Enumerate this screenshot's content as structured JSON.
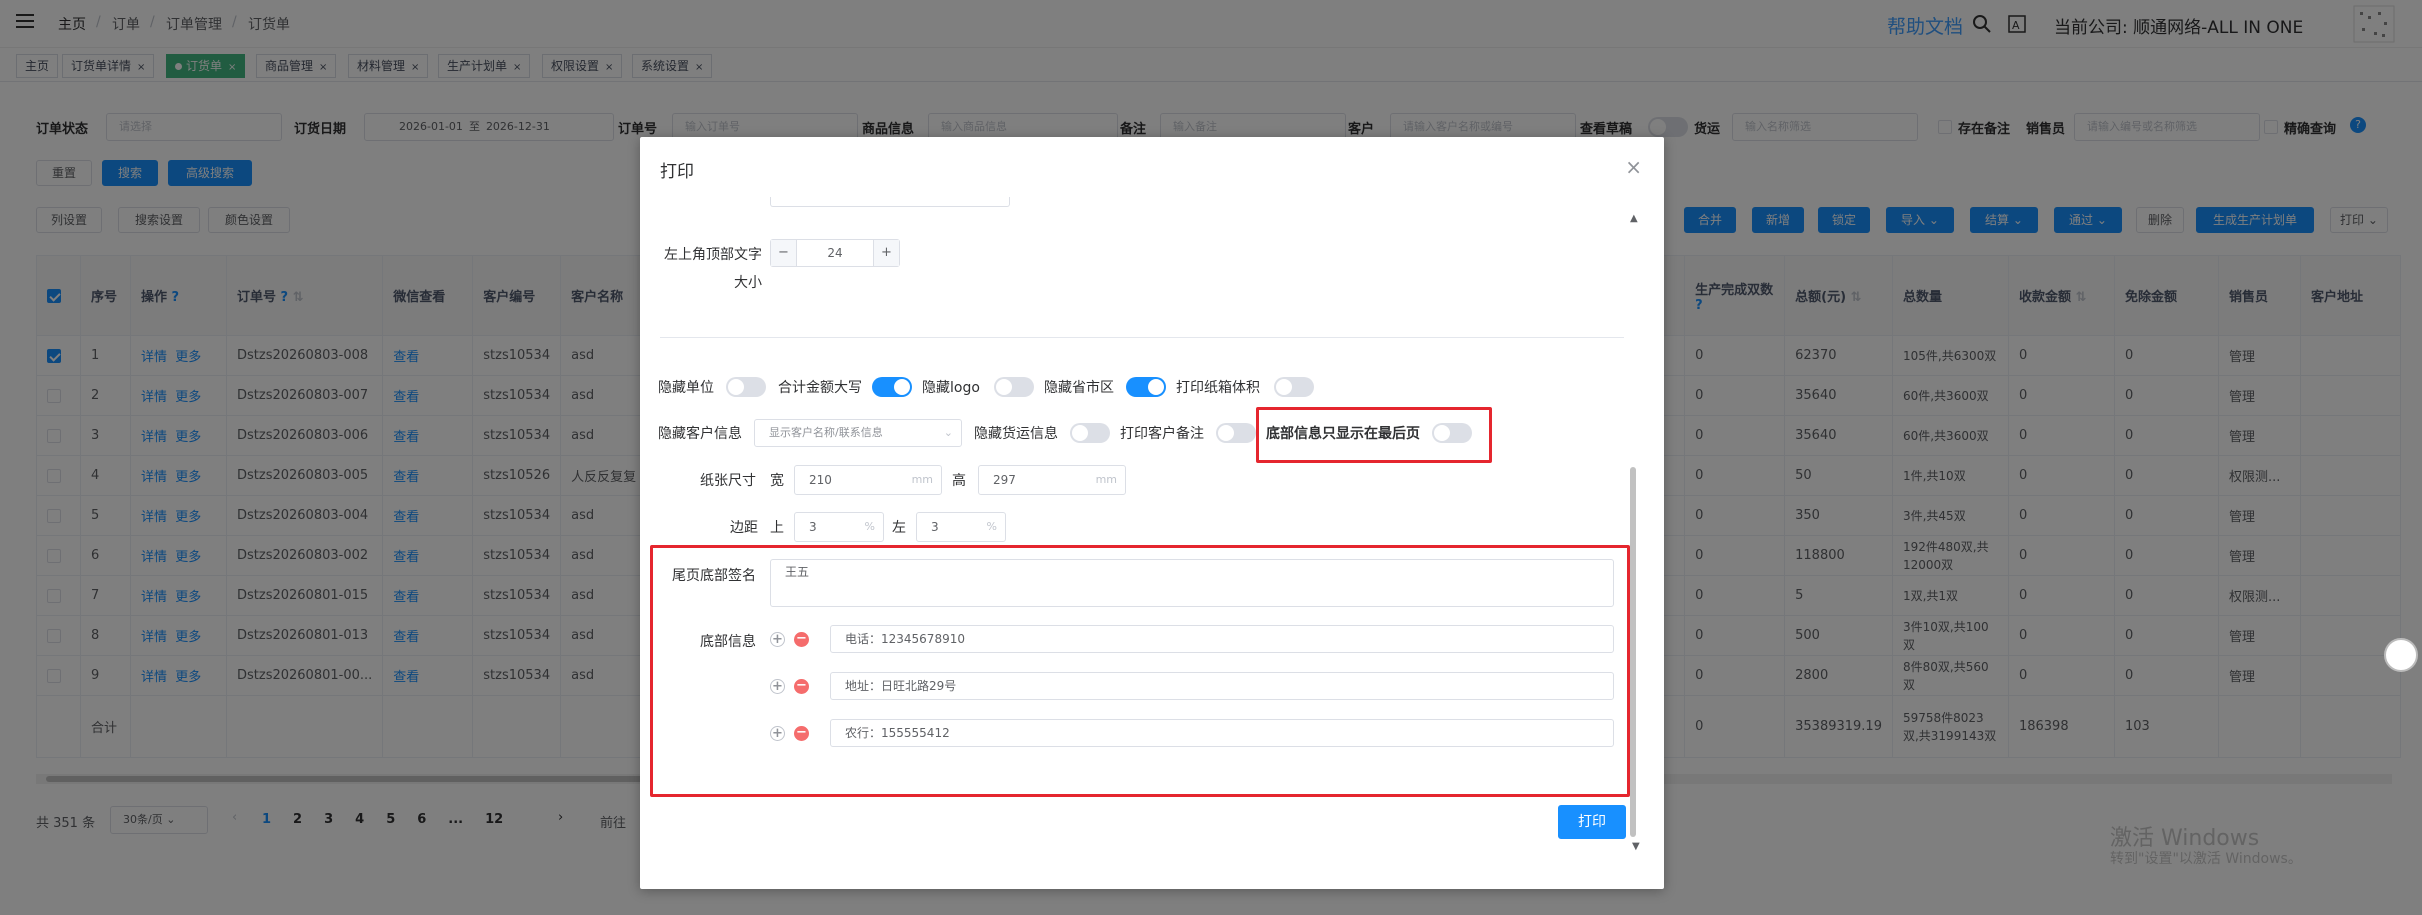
{
  "breadcrumb": [
    "主页",
    "订单",
    "订单管理",
    "订货单"
  ],
  "header": {
    "help": "帮助文档",
    "company": "当前公司: 顺通网络-ALL IN ONE"
  },
  "tags": [
    {
      "label": "主页",
      "closable": false,
      "active": false
    },
    {
      "label": "订货单详情",
      "closable": true,
      "active": false
    },
    {
      "label": "订货单",
      "closable": true,
      "active": true
    },
    {
      "label": "商品管理",
      "closable": true,
      "active": false
    },
    {
      "label": "材料管理",
      "closable": true,
      "active": false
    },
    {
      "label": "生产计划单",
      "closable": true,
      "active": false
    },
    {
      "label": "权限设置",
      "closable": true,
      "active": false
    },
    {
      "label": "系统设置",
      "closable": true,
      "active": false
    }
  ],
  "filters": {
    "order_status": "订单状态",
    "status_ph": "请选择",
    "order_date": "订货日期",
    "date_from": "2026-01-01",
    "date_sep": "至",
    "date_to": "2026-12-31",
    "order_no": "订单号",
    "order_no_ph": "输入订单号",
    "goods": "商品信息",
    "goods_ph": "输入商品信息",
    "remark": "备注",
    "remark_ph": "输入备注",
    "customer": "客户",
    "customer_ph": "请输入客户名称或编号",
    "draft": "查看草稿",
    "ship": "货运",
    "ship_ph": "输入名称筛选",
    "has_remark": "存在备注",
    "sales": "销售员",
    "sales_ph": "请输入编号或名称筛选",
    "exact": "精确查询"
  },
  "buttons": {
    "reset": "重置",
    "search": "搜索",
    "adv_search": "高级搜索",
    "col_settings": "列设置",
    "search_settings": "搜索设置",
    "color_settings": "颜色设置",
    "merge": "合并",
    "add": "新增",
    "lock": "锁定",
    "import": "导入",
    "settle": "结算",
    "pass": "通过",
    "delete": "删除",
    "gen_plan": "生成生产计划单",
    "print": "打印"
  },
  "table": {
    "headers_left": [
      "序号",
      "操作",
      "订单号",
      "微信查看",
      "客户编号",
      "客户名称"
    ],
    "headers_right": [
      "生产完成双数",
      "总额(元)",
      "总数量",
      "收款金额",
      "免除金额",
      "销售员",
      "客户地址"
    ],
    "rows": [
      {
        "no": "1",
        "detail": "详情",
        "more": "更多",
        "order": "Dstzs20260803-008",
        "view": "查看",
        "cust": "stzs10534",
        "name": "asd",
        "done": "0",
        "total": "62370",
        "qty": "105件,共6300双",
        "paid": "0",
        "free": "0",
        "sales": "管理",
        "checked": true
      },
      {
        "no": "2",
        "detail": "详情",
        "more": "更多",
        "order": "Dstzs20260803-007",
        "view": "查看",
        "cust": "stzs10534",
        "name": "asd",
        "done": "0",
        "total": "35640",
        "qty": "60件,共3600双",
        "paid": "0",
        "free": "0",
        "sales": "管理",
        "checked": false
      },
      {
        "no": "3",
        "detail": "详情",
        "more": "更多",
        "order": "Dstzs20260803-006",
        "view": "查看",
        "cust": "stzs10534",
        "name": "asd",
        "done": "0",
        "total": "35640",
        "qty": "60件,共3600双",
        "paid": "0",
        "free": "0",
        "sales": "管理",
        "checked": false
      },
      {
        "no": "4",
        "detail": "详情",
        "more": "更多",
        "order": "Dstzs20260803-005",
        "view": "查看",
        "cust": "stzs10526",
        "name": "人反反复复",
        "done": "0",
        "total": "50",
        "qty": "1件,共10双",
        "paid": "0",
        "free": "0",
        "sales": "权限测...",
        "checked": false
      },
      {
        "no": "5",
        "detail": "详情",
        "more": "更多",
        "order": "Dstzs20260803-004",
        "view": "查看",
        "cust": "stzs10534",
        "name": "asd",
        "done": "0",
        "total": "350",
        "qty": "3件,共45双",
        "paid": "0",
        "free": "0",
        "sales": "管理",
        "checked": false
      },
      {
        "no": "6",
        "detail": "详情",
        "more": "更多",
        "order": "Dstzs20260803-002",
        "view": "查看",
        "cust": "stzs10534",
        "name": "asd",
        "done": "0",
        "total": "118800",
        "qty": "192件480双,共12000双",
        "paid": "0",
        "free": "0",
        "sales": "管理",
        "checked": false
      },
      {
        "no": "7",
        "detail": "详情",
        "more": "更多",
        "order": "Dstzs20260801-015",
        "view": "查看",
        "cust": "stzs10534",
        "name": "asd",
        "done": "0",
        "total": "5",
        "qty": "1双,共1双",
        "paid": "0",
        "free": "0",
        "sales": "权限测...",
        "checked": false
      },
      {
        "no": "8",
        "detail": "详情",
        "more": "更多",
        "order": "Dstzs20260801-013",
        "view": "查看",
        "cust": "stzs10534",
        "name": "asd",
        "done": "0",
        "total": "500",
        "qty": "3件10双,共100双",
        "paid": "0",
        "free": "0",
        "sales": "管理",
        "checked": false
      },
      {
        "no": "9",
        "detail": "详情",
        "more": "更多",
        "order": "Dstzs20260801-00...",
        "view": "查看",
        "cust": "stzs10534",
        "name": "asd",
        "done": "0",
        "total": "2800",
        "qty": "8件80双,共560双",
        "paid": "0",
        "free": "0",
        "sales": "管理",
        "checked": false
      }
    ],
    "summary": {
      "label": "合计",
      "done": "0",
      "total": "35389319.19",
      "qty": "59758件8023双,共3199143双",
      "paid": "186398",
      "free": "103"
    }
  },
  "pagination": {
    "total": "共 351 条",
    "size": "30条/页",
    "pages": [
      "1",
      "2",
      "3",
      "4",
      "5",
      "6",
      "...",
      "12"
    ],
    "current": "1",
    "goto": "前往"
  },
  "dialog": {
    "title": "打印",
    "top_font_label": "左上角顶部文字大小",
    "top_font_value": "24",
    "toggles_row1": [
      {
        "label": "隐藏单位",
        "on": false
      },
      {
        "label": "合计金额大写",
        "on": true
      },
      {
        "label": "隐藏logo",
        "on": false
      },
      {
        "label": "隐藏省市区",
        "on": true
      },
      {
        "label": "打印纸箱体积",
        "on": false
      }
    ],
    "hide_cust_label": "隐藏客户信息",
    "hide_cust_value": "显示客户名称/联系信息",
    "toggles_row2": [
      {
        "label": "隐藏货运信息",
        "on": false
      },
      {
        "label": "打印客户备注",
        "on": false
      }
    ],
    "footer_last_label": "底部信息只显示在最后页",
    "footer_last_on": false,
    "paper_label": "纸张尺寸",
    "width_label": "宽",
    "width_value": "210",
    "height_label": "高",
    "height_value": "297",
    "mm": "mm",
    "margin_label": "边距",
    "top_label": "上",
    "top_value": "3",
    "left_label": "左",
    "left_value": "3",
    "pct": "%",
    "signature_label": "尾页底部签名",
    "signature_value": "王五",
    "footer_info_label": "底部信息",
    "footer_items": [
      "电话：12345678910",
      "地址：日旺北路29号",
      "农行：155555412"
    ],
    "print_button": "打印"
  },
  "watermark": {
    "line1": "激活 Windows",
    "line2": "转到\"设置\"以激活 Windows。"
  },
  "colors": {
    "primary": "#1890ff",
    "highlight": "#e5262e",
    "tag_active": "#42b983"
  }
}
